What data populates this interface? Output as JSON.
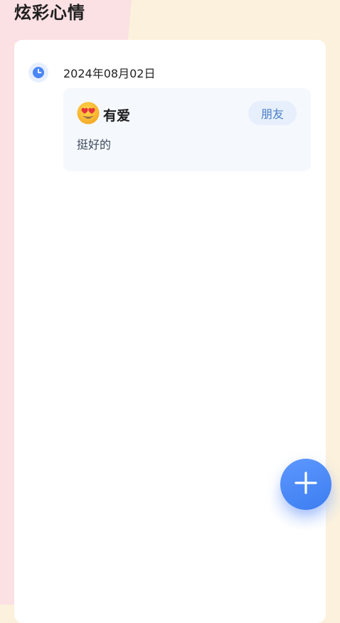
{
  "header": {
    "title": "炫彩心情"
  },
  "entry": {
    "date": "2024年08月02日",
    "mood": {
      "label": "有爱",
      "icon": "heart-eyes-emoji"
    },
    "tag": "朋友",
    "note": "挺好的"
  },
  "fab": {
    "icon": "plus-icon"
  },
  "colors": {
    "accent": "#4a86f7",
    "tag_text": "#4a7fc9",
    "tag_bg": "#e6effb",
    "pink_bg": "#fbe0e4",
    "cream_bg": "#fbf1dc"
  }
}
